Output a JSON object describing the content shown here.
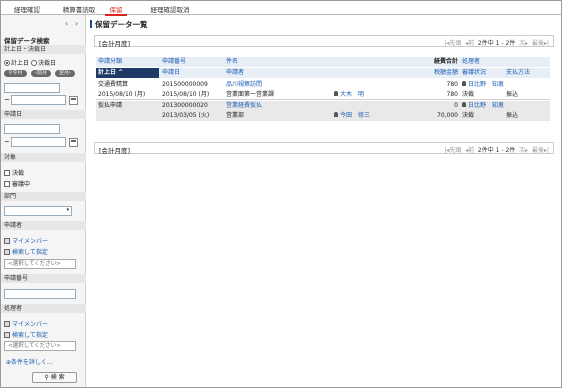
{
  "tabs": [
    "経理確認",
    "精算書読取",
    "保留",
    "経理確認取消"
  ],
  "sidebar": {
    "title": "保留データ検索",
    "date_section": "計上日・決裁日",
    "radio_keijo": "計上日",
    "radio_kessai": "決裁日",
    "btn_today": "今月",
    "btn_prev": "前月",
    "btn_next": "翌月",
    "tilde": "~",
    "apply_date_section": "申請日",
    "target_section": "対象",
    "chk_kessai": "決裁",
    "chk_shinsei": "審議中",
    "dept_section": "部門",
    "applicant_section": "申請者",
    "my_member": "マイメンバー",
    "search_assign": "検索して指定",
    "select_placeholder": "<選択してください>",
    "apply_no_section": "申請番号",
    "handler_section": "処理者",
    "more_conditions": "条件を詳しく...",
    "search_button": "検 索"
  },
  "main": {
    "title": "保留データ一覧",
    "fiscal": "[会計月度]",
    "pager": {
      "first": "先頭",
      "prev": "前",
      "range": "2件中 1 - 2件",
      "next": "次",
      "last": "最後"
    },
    "headers_top": [
      "申請分類",
      "申請番号",
      "件名",
      "",
      "経費合計",
      "処理者",
      ""
    ],
    "headers_bottom": [
      "計上日 ^",
      "申請日",
      "申請者",
      "",
      "税額金額",
      "審議状況",
      "支払方法"
    ],
    "rows": [
      {
        "a": "交通費精算",
        "b": "201500000009",
        "c": "品川視察訪問",
        "d": "",
        "e": "780",
        "f": "日比野　知恵",
        "g": ""
      },
      {
        "a": "2015/08/10 (月)",
        "b": "2015/08/10 (月)",
        "c": "営業面第一営業課",
        "d": "大木　明",
        "e": "780",
        "f": "決裁",
        "g": "振込"
      },
      {
        "a": "仮払申請",
        "b": "201300000020",
        "c": "営業経費仮払",
        "d": "",
        "e": "0",
        "f": "日比野　知恵",
        "g": ""
      },
      {
        "a": "",
        "b": "2013/03/05 (火)",
        "c": "営業部",
        "d": "今田　修三",
        "e": "70,000",
        "f": "決裁",
        "g": "振込"
      }
    ]
  }
}
